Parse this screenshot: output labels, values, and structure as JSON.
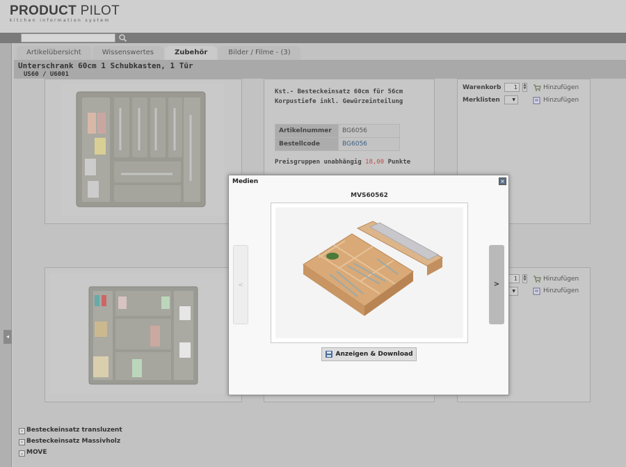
{
  "app": {
    "logo_main_bold": "PRODUCT",
    "logo_main_light": "PILOT",
    "logo_sub": "kitchen information system"
  },
  "search": {
    "value": "",
    "icon": "search-icon"
  },
  "tabs": [
    {
      "label": "Artikelübersicht",
      "active": false
    },
    {
      "label": "Wissenswertes",
      "active": false
    },
    {
      "label": "Zubehör",
      "active": true
    },
    {
      "label": "Bilder / Filme - (3)",
      "active": false
    }
  ],
  "article": {
    "title": "Unterschrank 60cm 1 Schubkasten, 1 Tür",
    "codes": "US60 / U6001"
  },
  "product1": {
    "desc_line1": "Kst.- Besteckeinsatz 60cm für 56cm",
    "desc_line2": "Korpustiefe inkl. Gewürzeinteilung",
    "table": [
      {
        "key": "Artikelnummer",
        "value": "BG6056"
      },
      {
        "key": "Bestellcode",
        "value": "BG6056"
      }
    ],
    "price_prefix": "Preisgruppen unabhängig",
    "price_value": "18,00",
    "price_suffix": "Punkte",
    "cart_label": "Warenkorb",
    "cart_qty": "1",
    "add_label": "Hinzufügen",
    "wishlist_label": "Merklisten",
    "wishlist_add": "Hinzufügen"
  },
  "product2": {
    "cart_qty": "1",
    "add_label": "Hinzufügen",
    "wishlist_add": "Hinzufügen"
  },
  "categories": [
    {
      "label": "Besteckeinsatz transluzent",
      "state": "collapsed"
    },
    {
      "label": "Besteckeinsatz Massivholz",
      "state": "collapsed"
    },
    {
      "label": "MOVE",
      "state": "expanded"
    }
  ],
  "modal": {
    "title": "Medien",
    "media_code": "MVS60562",
    "prev_label": "<",
    "next_label": ">",
    "download_label": "Anzeigen & Download",
    "close_symbol": "×"
  },
  "colors": {
    "accent_link": "#3a5e85",
    "price_red": "#c04a4a"
  }
}
